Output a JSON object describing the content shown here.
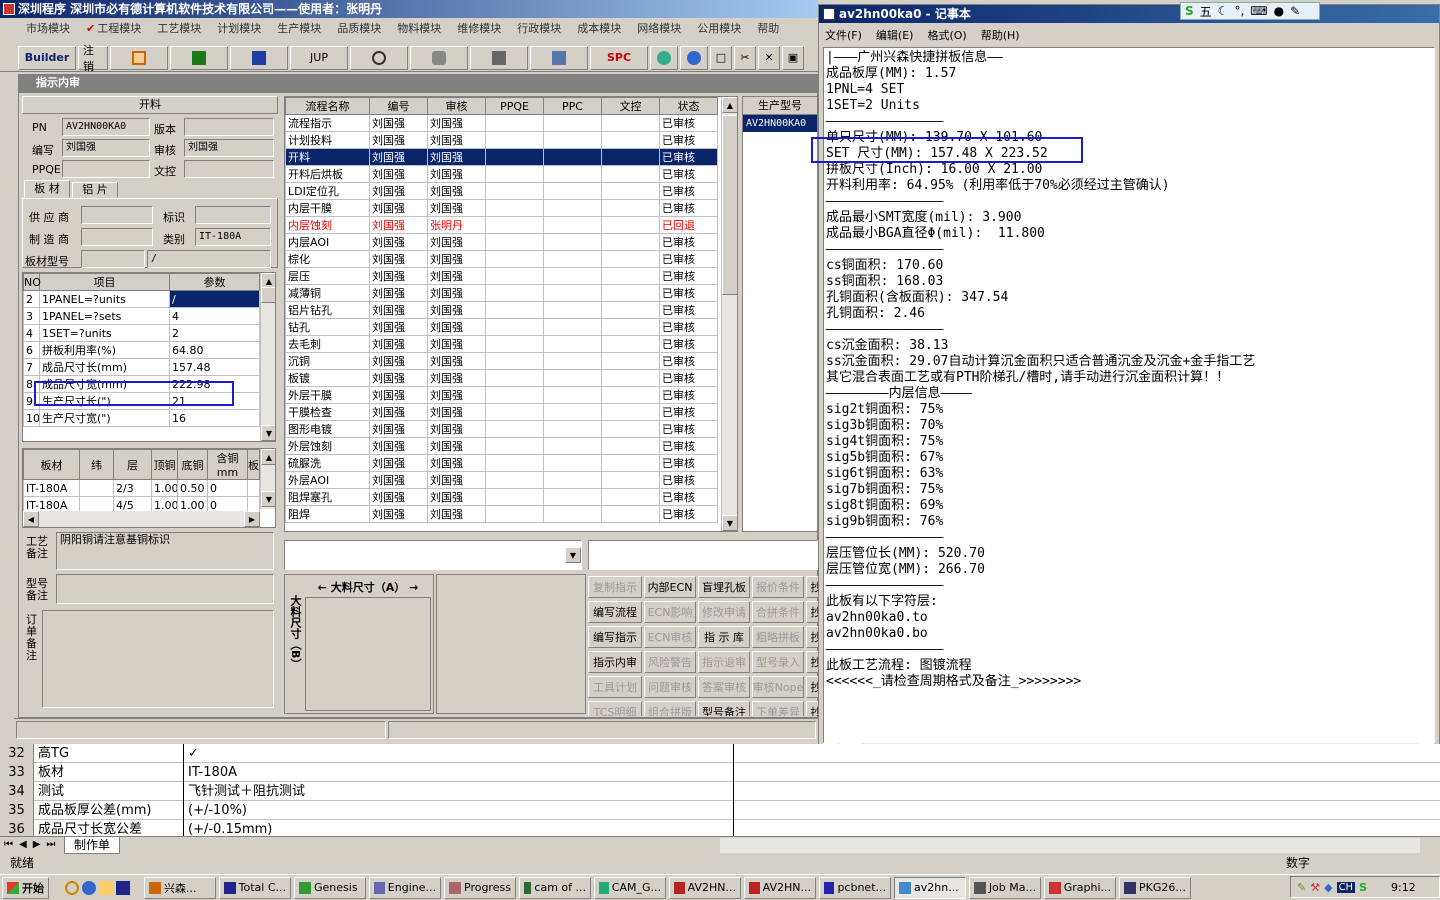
{
  "main_window": {
    "title": "深圳程序  深圳市必有德计算机软件技术有限公司——使用者：张明丹",
    "menu": [
      "市场模块",
      "工程模块",
      "工艺模块",
      "计划模块",
      "生产模块",
      "品质模块",
      "物料模块",
      "维修模块",
      "行政模块",
      "成本模块",
      "网络模块",
      "公用模块",
      "帮助"
    ],
    "checked_menu": "工程模块",
    "toolbar": [
      "Builder",
      "注销",
      "",
      "",
      "",
      "JUP",
      "",
      "",
      "",
      "",
      "SPC"
    ],
    "subwindow_title": "指示内审"
  },
  "left_panel": {
    "header": "开料",
    "fields": {
      "pn_label": "PN",
      "pn_value": "AV2HN00KA0",
      "version_label": "版本",
      "version_value": "",
      "author_label": "编写",
      "author_value": "刘国强",
      "review_label": "审核",
      "review_value": "刘国强",
      "ppqe_label": "PPQE",
      "ppqe_value": "",
      "wenkong_label": "文控",
      "wenkong_value": ""
    },
    "tabs": [
      "板 材",
      "铝 片"
    ],
    "material": {
      "supplier_label": "供 应 商",
      "mark_label": "标识",
      "maker_label": "制 造 商",
      "type_label": "类别",
      "type_value": "IT-180A",
      "model_label": "板材型号",
      "model_value": "/"
    },
    "param_headers": [
      "NO",
      "项目",
      "参数"
    ],
    "params": [
      [
        "2",
        "1PANEL=?units",
        "/"
      ],
      [
        "3",
        "1PANEL=?sets",
        "4"
      ],
      [
        "4",
        "1SET=?units",
        "2"
      ],
      [
        "6",
        "拼板利用率(%)",
        "64.80"
      ],
      [
        "7",
        "成品尺寸长(mm)",
        "157.48"
      ],
      [
        "8",
        "成品尺寸宽(mm)",
        "222.98"
      ],
      [
        "9",
        "生产尺寸长(\")",
        "21"
      ],
      [
        "10",
        "生产尺寸宽(\")",
        "16"
      ]
    ],
    "layer_headers": [
      "板材",
      "纬",
      "层",
      "顶铜",
      "底铜",
      "含铜mm",
      "板"
    ],
    "layers": [
      [
        "IT-180A",
        "",
        "2/3",
        "1.00",
        "0.50",
        "0",
        ""
      ],
      [
        "IT-180A",
        "",
        "4/5",
        "1.00",
        "1.00",
        "0",
        ""
      ]
    ],
    "craft_label": "工艺备注",
    "craft_value": "阴阳铜请注意基铜标识",
    "model_note_label": "型号备注",
    "order_note_label": "订单备注"
  },
  "process_table": {
    "headers": [
      "流程名称",
      "编号",
      "审核",
      "PPQE",
      "PPC",
      "文控",
      "状态"
    ],
    "rows": [
      [
        "流程指示",
        "刘国强",
        "刘国强",
        "",
        "",
        "",
        "已审核"
      ],
      [
        "计划投料",
        "刘国强",
        "刘国强",
        "",
        "",
        "",
        "已审核"
      ],
      [
        "开料",
        "刘国强",
        "刘国强",
        "",
        "",
        "",
        "已审核"
      ],
      [
        "开料后烘板",
        "刘国强",
        "刘国强",
        "",
        "",
        "",
        "已审核"
      ],
      [
        "LDI定位孔",
        "刘国强",
        "刘国强",
        "",
        "",
        "",
        "已审核"
      ],
      [
        "内层干膜",
        "刘国强",
        "刘国强",
        "",
        "",
        "",
        "已审核"
      ],
      [
        "内层蚀刻",
        "刘国强",
        "张明丹",
        "",
        "",
        "",
        "已回退"
      ],
      [
        "内层AOI",
        "刘国强",
        "刘国强",
        "",
        "",
        "",
        "已审核"
      ],
      [
        "棕化",
        "刘国强",
        "刘国强",
        "",
        "",
        "",
        "已审核"
      ],
      [
        "层压",
        "刘国强",
        "刘国强",
        "",
        "",
        "",
        "已审核"
      ],
      [
        "减薄铜",
        "刘国强",
        "刘国强",
        "",
        "",
        "",
        "已审核"
      ],
      [
        "铝片钻孔",
        "刘国强",
        "刘国强",
        "",
        "",
        "",
        "已审核"
      ],
      [
        "钻孔",
        "刘国强",
        "刘国强",
        "",
        "",
        "",
        "已审核"
      ],
      [
        "去毛刺",
        "刘国强",
        "刘国强",
        "",
        "",
        "",
        "已审核"
      ],
      [
        "沉铜",
        "刘国强",
        "刘国强",
        "",
        "",
        "",
        "已审核"
      ],
      [
        "板镀",
        "刘国强",
        "刘国强",
        "",
        "",
        "",
        "已审核"
      ],
      [
        "外层干膜",
        "刘国强",
        "刘国强",
        "",
        "",
        "",
        "已审核"
      ],
      [
        "干膜检查",
        "刘国强",
        "刘国强",
        "",
        "",
        "",
        "已审核"
      ],
      [
        "图形电镀",
        "刘国强",
        "刘国强",
        "",
        "",
        "",
        "已审核"
      ],
      [
        "外层蚀刻",
        "刘国强",
        "刘国强",
        "",
        "",
        "",
        "已审核"
      ],
      [
        "硫脲洗",
        "刘国强",
        "刘国强",
        "",
        "",
        "",
        "已审核"
      ],
      [
        "外层AOI",
        "刘国强",
        "刘国强",
        "",
        "",
        "",
        "已审核"
      ],
      [
        "阻焊塞孔",
        "刘国强",
        "刘国强",
        "",
        "",
        "",
        "已审核"
      ],
      [
        "阻焊",
        "刘国强",
        "刘国强",
        "",
        "",
        "",
        "已审核"
      ]
    ],
    "selected_row": 2,
    "red_row": 6
  },
  "model_column": {
    "header": "生产型号",
    "value": "AV2HN00KA0"
  },
  "dims": {
    "a_label": "大料尺寸（A）",
    "b_label": "大料尺寸（B）"
  },
  "buttons": [
    [
      "复制指示",
      "内部ECN",
      "盲埋孔板",
      "报价条件",
      "抄"
    ],
    [
      "编写流程",
      "ECN影响",
      "修改申请",
      "合拼条件",
      "抄"
    ],
    [
      "编写指示",
      "ECN审核",
      "指 示 库",
      "粗略拼板",
      "抄"
    ],
    [
      "指示内审",
      "风险警告",
      "指示退审",
      "型号录入",
      "抄"
    ],
    [
      "工具计划",
      "问题审核",
      "答案审核",
      "审核Nope",
      "抄"
    ],
    [
      "TCS明细",
      "组合拼版",
      "型号备注",
      "下单差异",
      "抄"
    ]
  ],
  "disabled_buttons": [
    "复制指示",
    "报价条件",
    "ECN影响",
    "修改申请",
    "合拼条件",
    "ECN审核",
    "粗略拼板",
    "风险警告",
    "指示退审",
    "型号录入",
    "工具计划",
    "问题审核",
    "答案审核",
    "审核Nope",
    "TCS明细",
    "组合拼版",
    "下单差异"
  ],
  "notepad": {
    "title": "av2hn00ka0 - 记事本",
    "menu": [
      "文件(F)",
      "编辑(E)",
      "格式(O)",
      "帮助(H)"
    ],
    "lines": [
      "|———广州兴森快捷拼板信息——",
      "成品板厚(MM): 1.57",
      "1PNL=4 SET",
      "1SET=2 Units",
      "———————————————",
      "单只尺寸(MM): 139.70 X 101.60",
      "SET 尺寸(MM): 157.48 X 223.52",
      "拼板尺寸(Inch): 16.00 X 21.00",
      "开料利用率: 64.95% (利用率低于70%必须经过主管确认)",
      "———————————————",
      "成品最小SMT宽度(mil): 3.900",
      "成品最小BGA直径Φ(mil):  11.800",
      "———————————————",
      "cs铜面积: 170.60",
      "ss铜面积: 168.03",
      "孔铜面积(含板面积): 347.54",
      "孔铜面积: 2.46",
      "———————————————",
      "cs沉金面积: 38.13",
      "ss沉金面积: 29.07自动计算沉金面积只适合普通沉金及沉金+金手指工艺",
      "其它混合表面工艺或有PTH阶梯孔/槽时,请手动进行沉金面积计算！！",
      "————————内层信息————",
      "sig2t铜面积: 75%",
      "sig3b铜面积: 70%",
      "sig4t铜面积: 75%",
      "sig5b铜面积: 67%",
      "sig6t铜面积: 63%",
      "sig7b铜面积: 75%",
      "sig8t铜面积: 69%",
      "sig9b铜面积: 76%",
      "———————————————",
      "层压管位长(MM): 520.70",
      "层压管位宽(MM): 266.70",
      "———————————————",
      "此板有以下字符层:",
      "av2hn00ka0.to",
      "av2hn00ka0.bo",
      "———————————————",
      "此板工艺流程: 图镀流程",
      "<<<<<<_请检查周期格式及备注_>>>>>>>>"
    ]
  },
  "sheet": {
    "rows": [
      [
        "32",
        "高TG",
        "✓"
      ],
      [
        "33",
        "板材",
        "IT-180A"
      ],
      [
        "34",
        "测试",
        "飞针测试＋阻抗测试"
      ],
      [
        "35",
        "成品板厚公差(mm)",
        "(+/-10%)"
      ],
      [
        "36",
        "成品尺寸长宽公差",
        "(+/-0.15mm)"
      ]
    ],
    "tab": "制作单"
  },
  "status": {
    "left": "就绪",
    "right": "数字"
  },
  "taskbar": {
    "start": "开始",
    "tasks": [
      "兴森...",
      "Total C...",
      "Genesis",
      "Engine...",
      "Progress",
      "cam of ...",
      "CAM_G...",
      "AV2HN...",
      "AV2HN...",
      "pcbnet...",
      "av2hn...",
      "Job Ma...",
      "Graphi...",
      "PKG26..."
    ],
    "ime": "CH",
    "clock": "9:12"
  },
  "ime_bar": "五"
}
